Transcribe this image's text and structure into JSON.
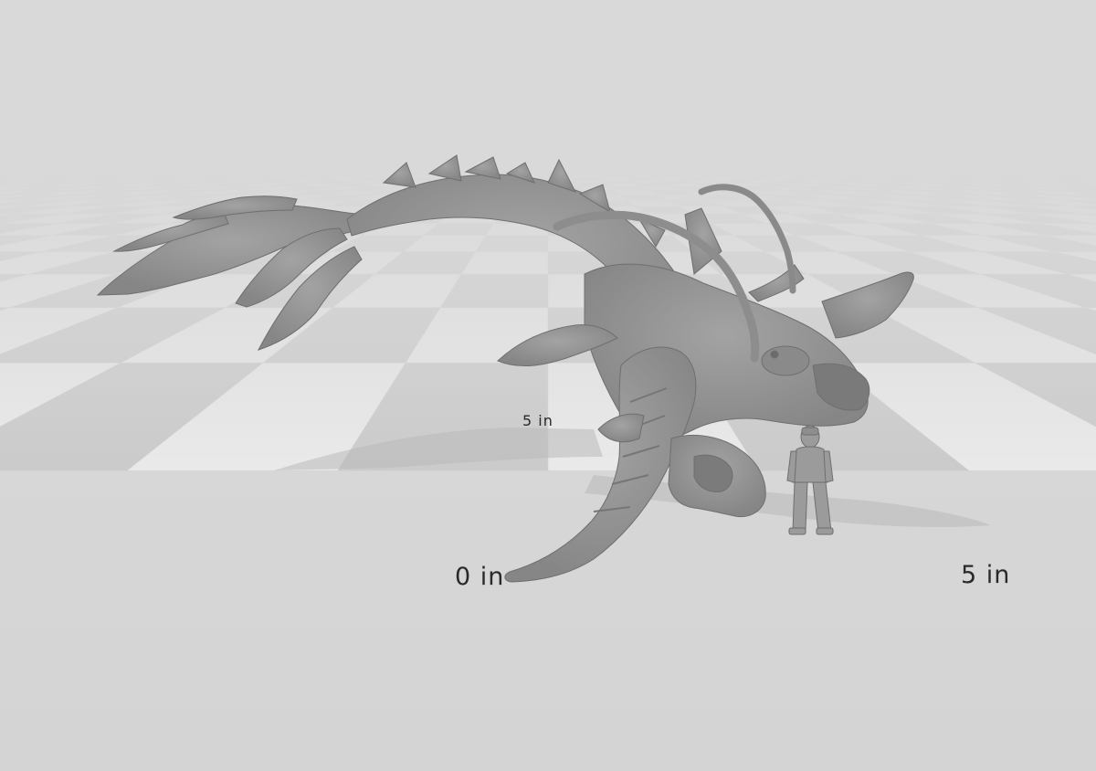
{
  "viewer": {
    "background_color": "#d8d8d8",
    "grid_light_color": "#e9e9e9",
    "grid_dark_color": "#cbcbcb",
    "model_color": "#8f8f8f"
  },
  "rulers": {
    "back_5in": "5 in",
    "front_0in": "0 in",
    "front_5in": "5 in"
  },
  "models": {
    "creature_icon": "sea-dragon-miniature",
    "figure_icon": "armored-human-scale-figure"
  }
}
